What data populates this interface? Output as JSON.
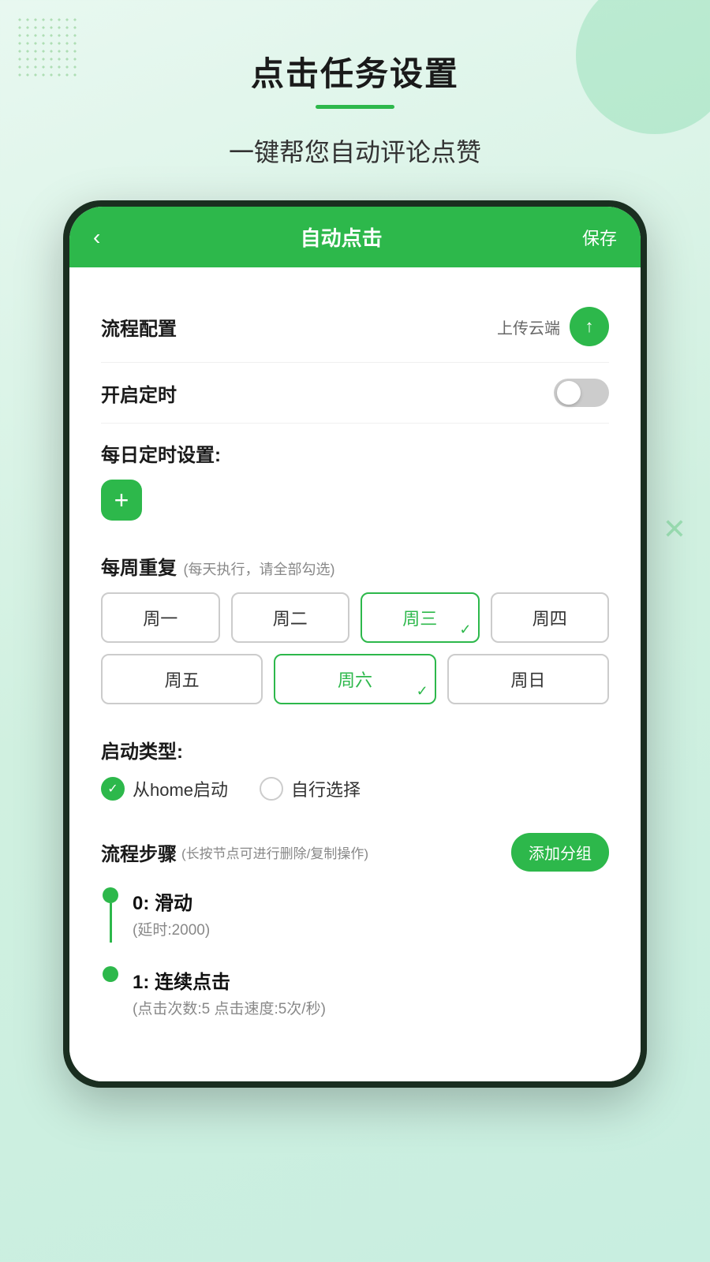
{
  "page": {
    "title": "点击任务设置",
    "subtitle": "一键帮您自动评论点赞",
    "title_underline_color": "#2db84b"
  },
  "header": {
    "back_label": "‹",
    "title": "自动点击",
    "save_label": "保存"
  },
  "sections": {
    "process_config": {
      "label": "流程配置",
      "upload_text": "上传云端",
      "upload_icon": "↑"
    },
    "timer": {
      "label": "开启定时",
      "enabled": false
    },
    "daily_schedule": {
      "label": "每日定时设置:"
    },
    "weekly_repeat": {
      "label": "每周重复",
      "sublabel": "(每天执行，请全部勾选)",
      "days": [
        {
          "id": "mon",
          "label": "周一",
          "selected": false
        },
        {
          "id": "tue",
          "label": "周二",
          "selected": false
        },
        {
          "id": "wed",
          "label": "周三",
          "selected": true
        },
        {
          "id": "thu",
          "label": "周四",
          "selected": false
        },
        {
          "id": "fri",
          "label": "周五",
          "selected": false
        },
        {
          "id": "sat",
          "label": "周六",
          "selected": true
        },
        {
          "id": "sun",
          "label": "周日",
          "selected": false
        }
      ]
    },
    "launch_type": {
      "label": "启动类型:",
      "options": [
        {
          "id": "home",
          "label": "从home启动",
          "selected": true
        },
        {
          "id": "custom",
          "label": "自行选择",
          "selected": false
        }
      ]
    },
    "process_steps": {
      "label": "流程步骤",
      "sublabel": "(长按节点可进行删除/复制操作)",
      "add_group_label": "添加分组",
      "steps": [
        {
          "index": 0,
          "name": "0: 滑动",
          "desc": "(延时:2000)"
        },
        {
          "index": 1,
          "name": "1: 连续点击",
          "desc": "(点击次数:5 点击速度:5次/秒)"
        }
      ]
    }
  },
  "colors": {
    "green": "#2db84b",
    "dark_green": "#1a2e20",
    "bg": "#d8f5e8"
  }
}
